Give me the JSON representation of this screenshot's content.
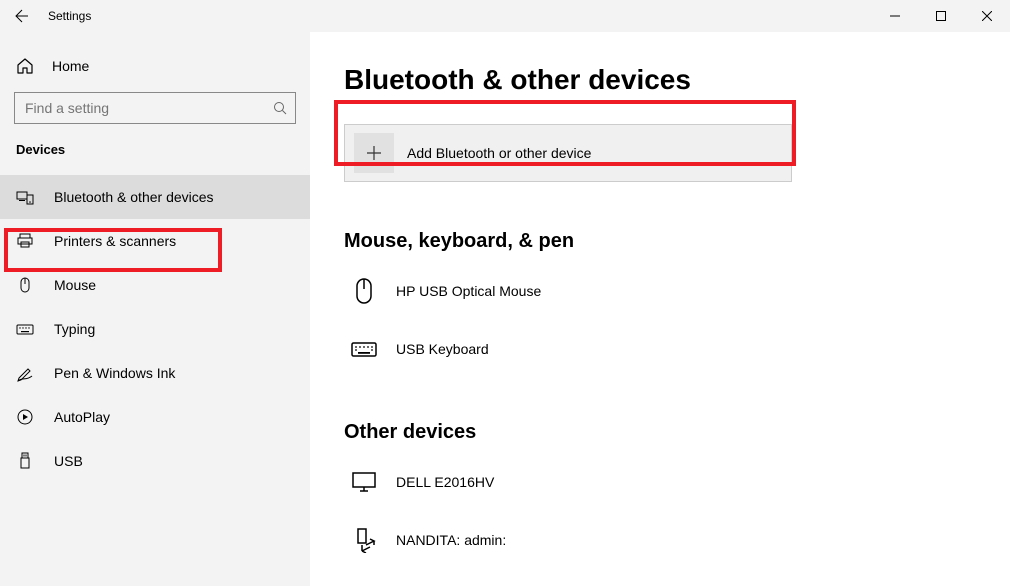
{
  "window": {
    "title": "Settings"
  },
  "sidebar": {
    "home_label": "Home",
    "search_placeholder": "Find a setting",
    "group_label": "Devices",
    "items": [
      {
        "label": "Bluetooth & other devices",
        "active": true
      },
      {
        "label": "Printers & scanners"
      },
      {
        "label": "Mouse"
      },
      {
        "label": "Typing"
      },
      {
        "label": "Pen & Windows Ink"
      },
      {
        "label": "AutoPlay"
      },
      {
        "label": "USB"
      }
    ]
  },
  "main": {
    "title": "Bluetooth & other devices",
    "add_label": "Add Bluetooth or other device",
    "sections": [
      {
        "title": "Mouse, keyboard, & pen",
        "devices": [
          {
            "name": "HP USB Optical Mouse"
          },
          {
            "name": "USB Keyboard"
          }
        ]
      },
      {
        "title": "Other devices",
        "devices": [
          {
            "name": "DELL E2016HV"
          },
          {
            "name": "NANDITA: admin:"
          }
        ]
      }
    ]
  },
  "annotations": {
    "highlight_color": "#ee1c25"
  }
}
